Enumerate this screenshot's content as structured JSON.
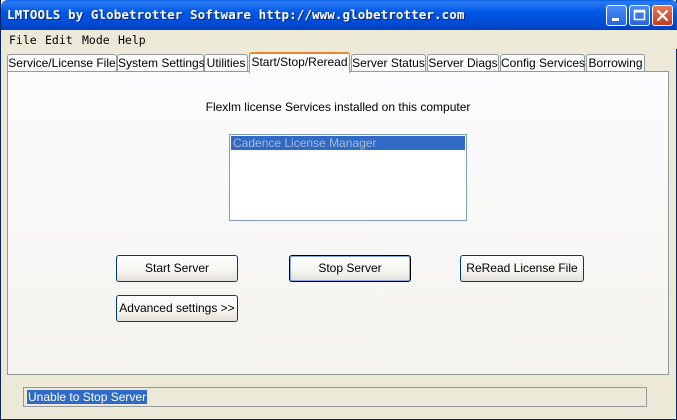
{
  "window": {
    "title": "LMTOOLS by Globetrotter Software http://www.globetrotter.com"
  },
  "menu": [
    "File",
    "Edit",
    "Mode",
    "Help"
  ],
  "tabs": [
    {
      "label": "Service/License File"
    },
    {
      "label": "System Settings"
    },
    {
      "label": "Utilities"
    },
    {
      "label": "Start/Stop/Reread",
      "active": true
    },
    {
      "label": "Server Status"
    },
    {
      "label": "Server Diags"
    },
    {
      "label": "Config Services"
    },
    {
      "label": "Borrowing"
    }
  ],
  "panel": {
    "caption": "Flexlm license Services installed on this computer",
    "services": [
      "Cadence License Manager"
    ],
    "buttons": {
      "start": "Start Server",
      "stop": "Stop Server",
      "reread": "ReRead License File",
      "advanced": "Advanced settings >>"
    }
  },
  "status": {
    "text": "Unable to Stop Server"
  },
  "colors": {
    "title_blue": "#0058e6",
    "selection": "#316ac5",
    "active_tab_accent": "#e68b2c",
    "face": "#ece9d8"
  }
}
